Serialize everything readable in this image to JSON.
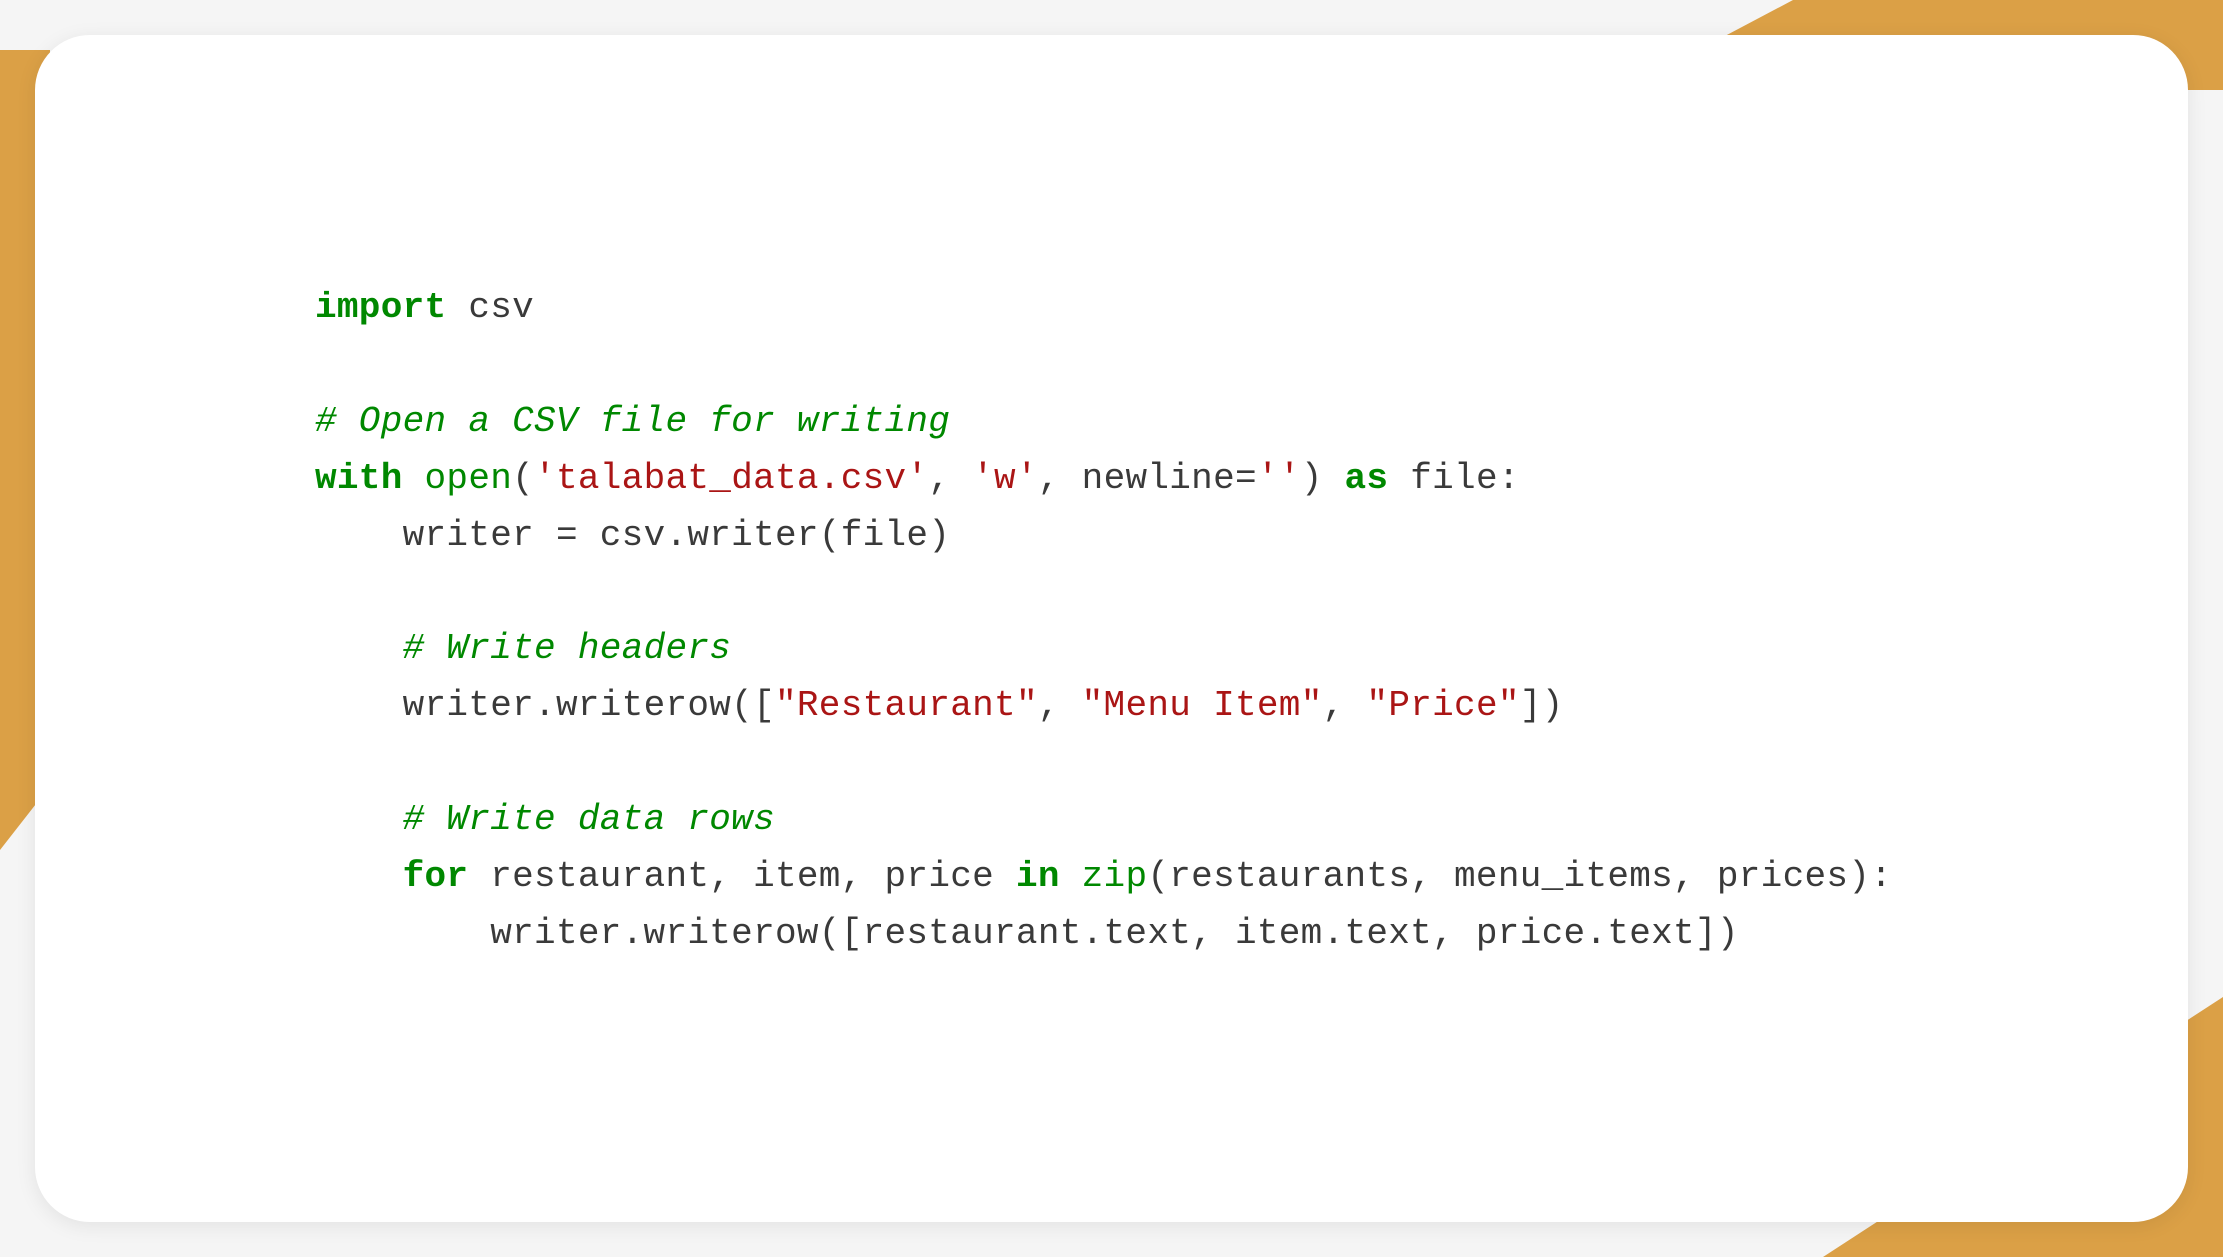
{
  "code": {
    "line1": {
      "kw_import": "import",
      "mod": " csv"
    },
    "line3": {
      "comment": "# Open a CSV file for writing"
    },
    "line4": {
      "kw_with": "with",
      "sp1": " ",
      "fn_open": "open",
      "paren1": "(",
      "str1": "'talabat_data.csv'",
      "comma1": ", ",
      "str2": "'w'",
      "comma2": ", newline=",
      "str3": "''",
      "paren2": ") ",
      "kw_as": "as",
      "rest": " file:"
    },
    "line5": {
      "indent": "    ",
      "text": "writer = csv.writer(file)"
    },
    "line7": {
      "indent": "    ",
      "comment": "# Write headers"
    },
    "line8": {
      "indent": "    ",
      "pre": "writer.writerow([",
      "str1": "\"Restaurant\"",
      "c1": ", ",
      "str2": "\"Menu Item\"",
      "c2": ", ",
      "str3": "\"Price\"",
      "post": "])"
    },
    "line10": {
      "indent": "    ",
      "comment": "# Write data rows"
    },
    "line11": {
      "indent": "    ",
      "kw_for": "for",
      "mid": " restaurant, item, price ",
      "kw_in": "in",
      "sp": " ",
      "fn_zip": "zip",
      "rest": "(restaurants, menu_items, prices):"
    },
    "line12": {
      "indent": "        ",
      "text": "writer.writerow([restaurant.text, item.text, price.text])"
    }
  }
}
